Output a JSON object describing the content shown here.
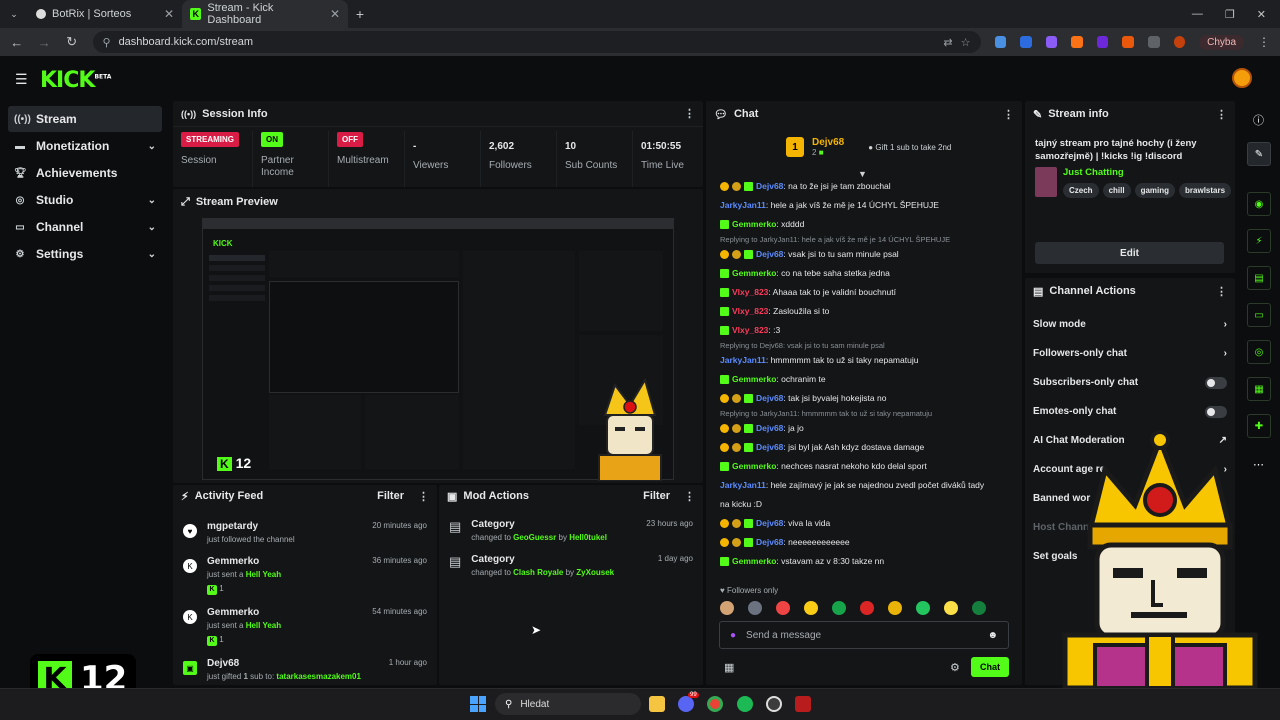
{
  "browser": {
    "tabs": [
      {
        "title": "BotRix | Sorteos",
        "active": false
      },
      {
        "title": "Stream - Kick Dashboard",
        "active": true
      }
    ],
    "url": "dashboard.kick.com/stream",
    "profile_badge": "Chyba"
  },
  "header": {
    "logo": "KICK",
    "logo_sup": "BETA"
  },
  "sidebar": {
    "items": [
      {
        "label": "Stream",
        "icon": "radio-icon",
        "active": true
      },
      {
        "label": "Monetization",
        "icon": "money-icon",
        "chevron": true
      },
      {
        "label": "Achievements",
        "icon": "trophy-icon"
      },
      {
        "label": "Studio",
        "icon": "studio-icon",
        "chevron": true
      },
      {
        "label": "Channel",
        "icon": "channel-icon",
        "chevron": true
      },
      {
        "label": "Settings",
        "icon": "gear-icon",
        "chevron": true
      }
    ]
  },
  "session": {
    "title": "Session Info",
    "streaming": "STREAMING",
    "session_label": "Session",
    "partner_pill": "ON",
    "partner_label": "Partner Income",
    "multistream_pill": "OFF",
    "multistream_label": "Multistream",
    "viewers_val": "-",
    "viewers_label": "Viewers",
    "followers_val": "2,602",
    "followers_label": "Followers",
    "subs_val": "10",
    "subs_label": "Sub Counts",
    "time_val": "01:50:55",
    "time_label": "Time Live"
  },
  "preview": {
    "title": "Stream Preview",
    "overlay_count": "12"
  },
  "activity": {
    "title": "Activity Feed",
    "filter": "Filter",
    "items": [
      {
        "name": "mgpetardy",
        "text": "just followed the channel",
        "time": "20 minutes ago"
      },
      {
        "name": "Gemmerko",
        "text": "just sent a",
        "highlight": "Hell Yeah",
        "count": "1",
        "time": "36 minutes ago"
      },
      {
        "name": "Gemmerko",
        "text": "just sent a",
        "highlight": "Hell Yeah",
        "count": "1",
        "time": "54 minutes ago"
      },
      {
        "name": "Dejv68",
        "text_a": "just gifted",
        "num": "1",
        "text_b": "sub to:",
        "highlight": "tatarkasesmazakem01",
        "time": "1 hour ago"
      }
    ]
  },
  "mod": {
    "title": "Mod Actions",
    "filter": "Filter",
    "items": [
      {
        "title": "Category",
        "prefix": "changed to",
        "value": "GeoGuessr",
        "by": "by",
        "user": "Hell0tukel",
        "time": "23 hours ago"
      },
      {
        "title": "Category",
        "prefix": "changed to",
        "value": "Clash Royale",
        "by": "by",
        "user": "ZyXousek",
        "time": "1 day ago"
      }
    ]
  },
  "chat": {
    "title": "Chat",
    "top_user": "Dejv68",
    "top_count": "2",
    "gift_prompt": "Gift 1 sub to take 2nd",
    "followers_only": "Followers only",
    "placeholder": "Send a message",
    "send": "Chat",
    "lines": [
      {
        "user": "Dejv68",
        "color": "blue",
        "badges": true,
        "msg": ": na to že jsi je tam zbouchal"
      },
      {
        "user": "JarkyJan11",
        "color": "blue",
        "msg": ": hele a jak víš že mě je 14 ÚCHYL ŠPEHUJE"
      },
      {
        "user": "Gemmerko",
        "color": "green",
        "kick": true,
        "msg": ": xdddd"
      },
      {
        "reply": "Replying to JarkyJan11: hele a jak víš že mě je 14 ÚCHYL ŠPEHUJE"
      },
      {
        "user": "Dejv68",
        "color": "blue",
        "badges": true,
        "msg": ": vsak jsi to tu sam minule psal"
      },
      {
        "user": "Gemmerko",
        "color": "green",
        "kick": true,
        "msg": ": co na tebe saha stetka jedna"
      },
      {
        "user": "Vlxy_823",
        "color": "red",
        "kick": true,
        "msg": ": Ahaaa tak to je validní bouchnutí"
      },
      {
        "user": "Vlxy_823",
        "color": "red",
        "kick": true,
        "msg": ": Zasloužila si to"
      },
      {
        "user": "Vlxy_823",
        "color": "red",
        "kick": true,
        "msg": ": :3"
      },
      {
        "reply": "Replying to Dejv68: vsak jsi to tu sam minule psal"
      },
      {
        "user": "JarkyJan11",
        "color": "blue",
        "msg": ": hmmmmm tak to už si taky nepamatuju"
      },
      {
        "user": "Gemmerko",
        "color": "green",
        "kick": true,
        "msg": ": ochranim te"
      },
      {
        "user": "Dejv68",
        "color": "blue",
        "badges": true,
        "msg": ": tak jsi byvalej hokejista no"
      },
      {
        "reply": "Replying to JarkyJan11: hmmmmm tak to už si taky nepamatuju"
      },
      {
        "user": "Dejv68",
        "color": "blue",
        "badges": true,
        "msg": ": ja jo"
      },
      {
        "user": "Dejv68",
        "color": "blue",
        "badges": true,
        "msg": ": jsi byl jak Ash kdyz dostava damage"
      },
      {
        "user": "Gemmerko",
        "color": "green",
        "kick": true,
        "msg": ": nechces nasrat nekoho kdo delal sport"
      },
      {
        "user": "JarkyJan11",
        "color": "blue",
        "msg": ": hele zajímavý je jak se najednou zvedl počet diváků tady"
      },
      {
        "cont": "na kicku :D"
      },
      {
        "user": "Dejv68",
        "color": "blue",
        "badges": true,
        "msg": ": viva la vida"
      },
      {
        "user": "Dejv68",
        "color": "blue",
        "badges": true,
        "msg": ": neeeeeeeeeeee"
      },
      {
        "user": "Gemmerko",
        "color": "green",
        "kick": true,
        "msg": ": vstavam az v 8:30 takze nn"
      }
    ]
  },
  "stream_info": {
    "title": "Stream info",
    "stream_title": "tajný stream pro tajné hochy (i ženy samozřejmě) | !kicks !ig !discord",
    "category": "Just Chatting",
    "tags": [
      "Czech",
      "chill",
      "gaming",
      "brawlstars"
    ],
    "edit": "Edit"
  },
  "channel_actions": {
    "title": "Channel Actions",
    "rows": [
      {
        "label": "Slow mode",
        "type": "chevron"
      },
      {
        "label": "Followers-only chat",
        "type": "chevron"
      },
      {
        "label": "Subscribers-only chat",
        "type": "toggle"
      },
      {
        "label": "Emotes-only chat",
        "type": "toggle"
      },
      {
        "label": "AI Chat Moderation",
        "type": "external"
      },
      {
        "label": "Account age re",
        "type": "chevron"
      },
      {
        "label": "Banned wor",
        "type": "none"
      },
      {
        "label": "Host Chann",
        "type": "none",
        "dim": true
      },
      {
        "label": "Set goals",
        "type": "none"
      }
    ]
  },
  "overlay": {
    "badge_count": "12"
  },
  "taskbar": {
    "search": "Hledat",
    "notif": "99"
  },
  "colors": {
    "kick_green": "#53fc18",
    "streaming_red": "#d81c45",
    "bg": "#0b0d0f",
    "panel": "#131517"
  }
}
